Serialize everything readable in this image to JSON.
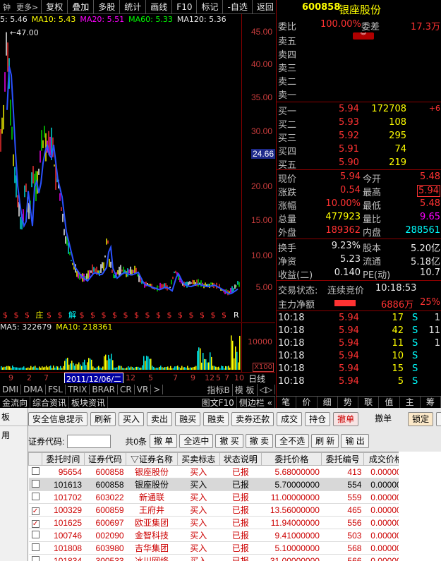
{
  "toolbar": {
    "prefix": "钟",
    "more": "更多>",
    "buttons": [
      "复权",
      "叠加",
      "多股",
      "统计",
      "画线",
      "F10",
      "标记",
      "-自选",
      "返回"
    ]
  },
  "chart": {
    "ma_legend": [
      {
        "label": "5: 5.46",
        "color": "#e8e8e8"
      },
      {
        "label": "MA10: 5.43",
        "color": "#ffff00"
      },
      {
        "label": "MA20: 5.51",
        "color": "#ff00ff"
      },
      {
        "label": "MA60: 5.33",
        "color": "#00ff00"
      },
      {
        "label": "MA120: 5.36",
        "color": "#e8e8e8"
      }
    ],
    "high_label": "47.00",
    "price_scale": [
      "45.00",
      "40.00",
      "35.00",
      "30.00",
      "24.66",
      "20.00",
      "15.00",
      "10.00",
      "5.00"
    ],
    "vol_legend": [
      {
        "label": "MA5: 322679",
        "color": "#e8e8e8"
      },
      {
        "label": "MA10: 218361",
        "color": "#ffff00"
      }
    ],
    "vol_scale": [
      "10000",
      "X100"
    ],
    "date_label": "2011/12/06/二",
    "date_ticks": [
      "9",
      "2",
      "7",
      "8",
      "12",
      "5",
      "7",
      "9",
      "12",
      "5",
      "7",
      "10"
    ],
    "period_label": "日线",
    "markers": [
      "$",
      "$",
      "$",
      "庄",
      "$",
      "$",
      "解",
      "$",
      "$",
      "$",
      "$",
      "$",
      "$",
      "$",
      "$",
      "$",
      "$",
      "$",
      "$",
      "$",
      "$",
      "R"
    ]
  },
  "indicators": {
    "items": [
      "DMI",
      "DMA",
      "FSL",
      "TRIX",
      "BRAR",
      "CR",
      "VR",
      ">"
    ],
    "right": [
      "指标B",
      "模 板",
      "◁▷"
    ]
  },
  "linkbar": {
    "items": [
      "金流向",
      "综合资讯",
      "板块资讯"
    ],
    "right": "图文F10",
    "right2": "侧边栏 «"
  },
  "quote": {
    "code": "600858",
    "name": "银座股份",
    "weibi_label": "委比",
    "weibi": "100.00%",
    "weicha_label": "委差",
    "weicha": "17.3万",
    "sell": [
      {
        "l": "卖五"
      },
      {
        "l": "卖四"
      },
      {
        "l": "卖三"
      },
      {
        "l": "卖二"
      },
      {
        "l": "卖一"
      }
    ],
    "buy": [
      {
        "l": "买一",
        "p": "5.94",
        "v": "172708",
        "x": "+6"
      },
      {
        "l": "买二",
        "p": "5.93",
        "v": "108",
        "x": ""
      },
      {
        "l": "买三",
        "p": "5.92",
        "v": "295",
        "x": ""
      },
      {
        "l": "买四",
        "p": "5.91",
        "v": "74",
        "x": ""
      },
      {
        "l": "买五",
        "p": "5.90",
        "v": "219",
        "x": ""
      }
    ],
    "stats": [
      {
        "l1": "现价",
        "v1": "5.94",
        "l2": "今开",
        "v2": "5.48",
        "c1": "red",
        "c2": "red"
      },
      {
        "l1": "涨跌",
        "v1": "0.54",
        "l2": "最高",
        "v2": "5.94",
        "c1": "red",
        "c2": "red"
      },
      {
        "l1": "涨幅",
        "v1": "10.00%",
        "l2": "最低",
        "v2": "5.48",
        "c1": "red",
        "c2": "red"
      },
      {
        "l1": "总量",
        "v1": "477923",
        "l2": "量比",
        "v2": "9.65",
        "c1": "yel",
        "c2": "mag"
      },
      {
        "l1": "外盘",
        "v1": "189362",
        "l2": "内盘",
        "v2": "288561",
        "c1": "red",
        "c2": "cy"
      }
    ],
    "stats2": [
      {
        "l1": "换手",
        "v1": "9.23%",
        "l2": "股本",
        "v2": "5.20亿"
      },
      {
        "l1": "净资",
        "v1": "5.23",
        "l2": "流通",
        "v2": "5.18亿"
      },
      {
        "l1": "收益(二)",
        "v1": "0.140",
        "l2": "PE(动)",
        "v2": "10.7"
      }
    ],
    "status_label": "交易状态:",
    "status": "连续竞价",
    "status_time": "10:18:53",
    "flow_label": "主力净额",
    "flow_value": "6886万",
    "flow_pct": "25%",
    "ticks": [
      {
        "t": "10:18",
        "p": "5.94",
        "v": "17",
        "s": "S",
        "n": "1"
      },
      {
        "t": "10:18",
        "p": "5.94",
        "v": "42",
        "s": "S",
        "n": "11"
      },
      {
        "t": "10:18",
        "p": "5.94",
        "v": "11",
        "s": "S",
        "n": "1"
      },
      {
        "t": "10:18",
        "p": "5.94",
        "v": "10",
        "s": "S",
        "n": ""
      },
      {
        "t": "10:18",
        "p": "5.94",
        "v": "15",
        "s": "S",
        "n": ""
      },
      {
        "t": "10:18",
        "p": "5.94",
        "v": "5",
        "s": "S",
        "n": ""
      }
    ]
  },
  "tabs": [
    "笔",
    "价",
    "细",
    "势",
    "联",
    "值",
    "主",
    "筹"
  ],
  "trade": {
    "side_items": [
      "板",
      "用"
    ],
    "buttons": [
      "安全信息提示",
      "刷新",
      "买入",
      "卖出",
      "融买",
      "融卖",
      "卖券还款",
      "成交",
      "持仓",
      "撤单",
      "撤单",
      "锁定",
      "系统"
    ],
    "code_label": "证券代码:",
    "count": "共0条",
    "buttons2": [
      "撤 单",
      "全选中",
      "撤 买",
      "撤 卖",
      "全不选",
      "刷 新",
      "输 出"
    ],
    "columns": [
      "委托时间",
      "证券代码",
      "▽证券名称",
      "买卖标志",
      "状态说明",
      "委托价格",
      "委托编号",
      "成交价格",
      "托数量"
    ],
    "rows": [
      {
        "chk": "",
        "time": "95654",
        "code": "600858",
        "name": "银座股份",
        "side": "买入",
        "state": "已报",
        "price": "5.68000000",
        "no": "413",
        "deal": "0.000000"
      },
      {
        "chk": "",
        "time": "101613",
        "code": "600858",
        "name": "银座股份",
        "side": "买入",
        "state": "已报",
        "price": "5.70000000",
        "no": "554",
        "deal": "0.000000",
        "sel": true
      },
      {
        "chk": "",
        "time": "101702",
        "code": "603022",
        "name": "新通联",
        "side": "买入",
        "state": "已报",
        "price": "11.00000000",
        "no": "559",
        "deal": "0.000000"
      },
      {
        "chk": "✓",
        "time": "100329",
        "code": "600859",
        "name": "王府井",
        "side": "买入",
        "state": "已报",
        "price": "13.56000000",
        "no": "465",
        "deal": "0.000000"
      },
      {
        "chk": "✓",
        "time": "101625",
        "code": "600697",
        "name": "欧亚集团",
        "side": "买入",
        "state": "已报",
        "price": "11.94000000",
        "no": "556",
        "deal": "0.000000"
      },
      {
        "chk": "",
        "time": "100746",
        "code": "002090",
        "name": "金智科技",
        "side": "买入",
        "state": "已报",
        "price": "9.41000000",
        "no": "503",
        "deal": "0.000000"
      },
      {
        "chk": "",
        "time": "101808",
        "code": "603980",
        "name": "吉华集团",
        "side": "买入",
        "state": "已报",
        "price": "5.10000000",
        "no": "568",
        "deal": "0.000000"
      },
      {
        "chk": "",
        "time": "101834",
        "code": "300533",
        "name": "冰川网络",
        "side": "买入",
        "state": "已报",
        "price": "31.00000000",
        "no": "566",
        "deal": "0.000000"
      }
    ]
  }
}
